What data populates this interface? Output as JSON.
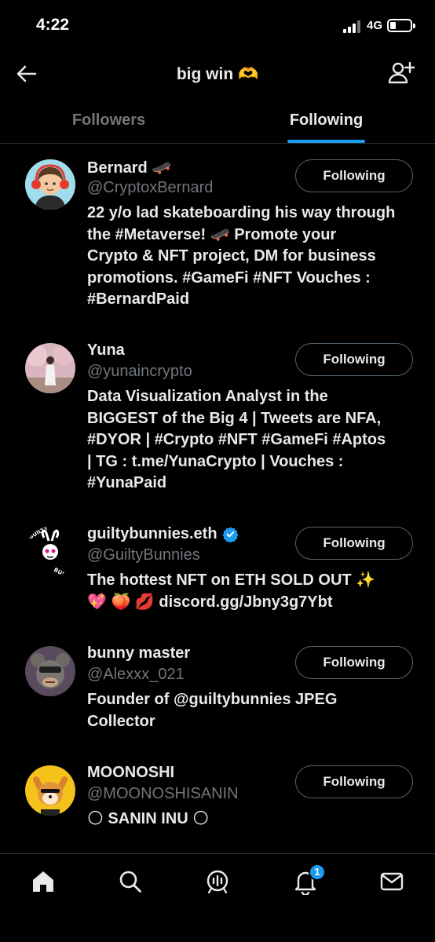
{
  "status_bar": {
    "time": "4:22",
    "network": "4G",
    "icons": [
      "signal-icon",
      "battery-icon"
    ]
  },
  "header": {
    "title": "big win 🫶",
    "icons": [
      "back-arrow-icon",
      "add-user-icon"
    ]
  },
  "tabs": [
    {
      "label": "Followers",
      "active": false
    },
    {
      "label": "Following",
      "active": true
    }
  ],
  "accent_color": "#1d9bf0",
  "users": [
    {
      "name": "Bernard 🛹",
      "handle": "@CryptoxBernard",
      "verified": false,
      "button": "Following",
      "bio_lines": [
        "22 y/o lad skateboarding his way through",
        "the #Metaverse! 🛹 Promote your",
        "Crypto & NFT project, DM for business",
        "promotions. #GameFi #NFT Vouches :",
        "#BernardPaid"
      ]
    },
    {
      "name": "Yuna",
      "handle": "@yunaincrypto",
      "verified": false,
      "button": "Following",
      "bio_lines": [
        "Data Visualization Analyst in the",
        "BIGGEST of the Big 4 | Tweets are NFA,",
        "#DYOR | #Crypto #NFT #GameFi #Aptos",
        "| TG : t.me/YunaCrypto | Vouches :",
        "#YunaPaid"
      ]
    },
    {
      "name": "guiltybunnies.eth",
      "handle": "@GuiltyBunnies",
      "verified": true,
      "button": "Following",
      "bio_lines": [
        "The hottest NFT on ETH SOLD OUT ✨",
        "💖 🍑 💋  discord.gg/Jbny3g7Ybt"
      ]
    },
    {
      "name": "bunny master",
      "handle": "@Alexxx_021",
      "verified": false,
      "button": "Following",
      "bio_lines": [
        "Founder of @guiltybunnies JPEG",
        "Collector"
      ]
    },
    {
      "name": "MOONOSHI",
      "handle": "@MOONOSHISANIN",
      "verified": false,
      "button": "Following",
      "bio_lines": [
        "🌕 SANIN INU 🌕"
      ]
    }
  ],
  "bottom_nav": {
    "items": [
      "home-icon",
      "search-icon",
      "spaces-icon",
      "notifications-icon",
      "messages-icon"
    ],
    "notification_count": "1"
  }
}
